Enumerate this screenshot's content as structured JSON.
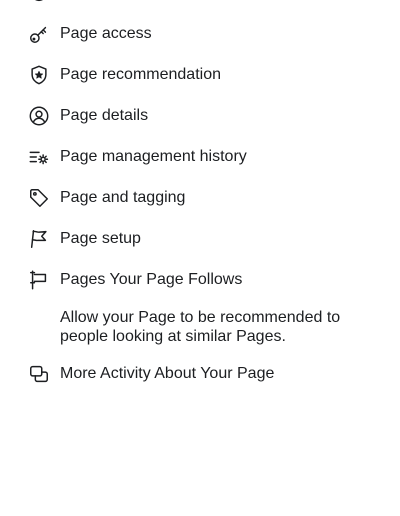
{
  "menu": {
    "items": [
      {
        "label": "Page access",
        "icon": "key-icon"
      },
      {
        "label": "Page recommendation",
        "icon": "shield-star-icon"
      },
      {
        "label": "Page details",
        "icon": "person-circle-icon"
      },
      {
        "label": "Page management history",
        "icon": "list-gear-icon"
      },
      {
        "label": "Page and tagging",
        "icon": "tag-icon"
      },
      {
        "label": "Page setup",
        "icon": "flag-icon"
      },
      {
        "label": "Pages Your Page Follows",
        "icon": "banner-flag-icon"
      }
    ],
    "description": "Allow your Page to be recommended to people looking at similar Pages.",
    "more": {
      "label": "More Activity About Your Page",
      "icon": "windows-icon"
    }
  }
}
